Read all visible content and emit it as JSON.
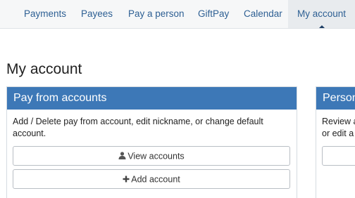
{
  "nav": {
    "items": [
      {
        "label": "Payments"
      },
      {
        "label": "Payees"
      },
      {
        "label": "Pay a person"
      },
      {
        "label": "GiftPay"
      },
      {
        "label": "Calendar"
      },
      {
        "label": "My account",
        "active": true
      }
    ]
  },
  "page": {
    "title": "My account"
  },
  "panels": [
    {
      "title": "Pay from accounts",
      "description": "Add / Delete pay from account, edit nickname, or change default account.",
      "buttons": [
        {
          "label": "View accounts",
          "icon": "user-icon"
        },
        {
          "label": "Add account",
          "icon": "plus-icon"
        }
      ]
    },
    {
      "title": "Person",
      "description_line1": "Review a",
      "description_line2": "or edit a"
    }
  ],
  "colors": {
    "nav_link": "#2d5f93",
    "panel_header": "#3d78b7"
  }
}
